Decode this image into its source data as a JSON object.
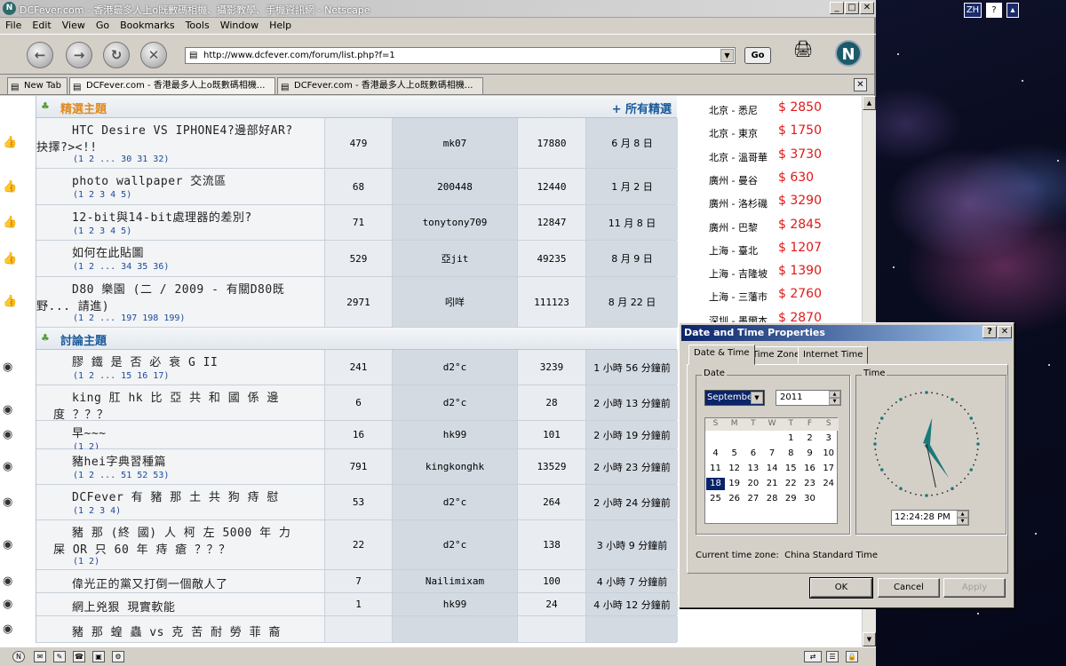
{
  "window": {
    "title": "DCFever.com - 香港最多人上o既數碼相機、攝影教學、手機資訊網 - Netscape",
    "minimize": "_",
    "maximize": "□",
    "close": "✕"
  },
  "tray": {
    "lang": "ZH",
    "help": "?"
  },
  "menu": [
    "File",
    "Edit",
    "View",
    "Go",
    "Bookmarks",
    "Tools",
    "Window",
    "Help"
  ],
  "nav": {
    "back": "←",
    "forward": "→",
    "reload": "↻",
    "stop": "✕",
    "url": "http://www.dcfever.com/forum/list.php?f=1",
    "go_label": "Go",
    "brand": "N"
  },
  "tabs": [
    {
      "label": "New Tab"
    },
    {
      "label": "DCFever.com - 香港最多人上o既數碼相機..."
    },
    {
      "label": "DCFever.com - 香港最多人上o既數碼相機..."
    }
  ],
  "tab_close": "✕",
  "forum": {
    "featured_header": "精選主題",
    "featured_link": "+ 所有精選",
    "discussion_header": "討論主題",
    "featured": [
      {
        "title1": "HTC Desire VS IPHONE4?邊部好AR?",
        "title2": "抉擇?><!!",
        "pages": "(1 2 ... 30 31 32)",
        "replies": "479",
        "author": "mk07",
        "views": "17880",
        "time": "6 月 8 日"
      },
      {
        "title1": "photo wallpaper 交流區",
        "title2": "",
        "pages": "(1 2 3 4 5)",
        "replies": "68",
        "author": "200448",
        "views": "12440",
        "time": "1 月 2 日"
      },
      {
        "title1": "12-bit與14-bit處理器的差別?",
        "title2": "",
        "pages": "(1 2 3 4 5)",
        "replies": "71",
        "author": "tonytony709",
        "views": "12847",
        "time": "11 月 8 日"
      },
      {
        "title1": "如何在此貼圖",
        "title2": "",
        "pages": "(1 2 ... 34 35 36)",
        "replies": "529",
        "author": "亞jit",
        "views": "49235",
        "time": "8 月 9 日"
      },
      {
        "title1": "D80 樂園 (二 / 2009 - 有關D80既",
        "title2": "野... 請進)",
        "pages": "(1 2 ... 197 198 199)",
        "replies": "2971",
        "author": "吲咩",
        "views": "111123",
        "time": "8 月 22 日"
      }
    ],
    "discussion": [
      {
        "title1": "膠 鐵 是 否 必 衰 G II",
        "title2": "",
        "pages": "(1 2 ... 15 16 17)",
        "replies": "241",
        "author": "d2°c",
        "views": "3239",
        "time": "1 小時 56 分鐘前"
      },
      {
        "title1": "king 肛 hk 比 亞 共 和 國 係 邊",
        "title2": "度 ？？？",
        "pages": "",
        "replies": "6",
        "author": "d2°c",
        "views": "28",
        "time": "2 小時 13 分鐘前"
      },
      {
        "title1": "早~~~",
        "title2": "",
        "pages": "(1 2)",
        "replies": "16",
        "author": "hk99",
        "views": "101",
        "time": "2 小時 19 分鐘前"
      },
      {
        "title1": "豬hei字典習種篇",
        "title2": "",
        "pages": "(1 2 ... 51 52 53)",
        "replies": "791",
        "author": "kingkonghk",
        "views": "13529",
        "time": "2 小時 23 分鐘前"
      },
      {
        "title1": "DCFever 有 豬 那 土 共 狗 痔 慰",
        "title2": "",
        "pages": "(1 2 3 4)",
        "replies": "53",
        "author": "d2°c",
        "views": "264",
        "time": "2 小時 24 分鐘前"
      },
      {
        "title1": "豬 那 (終 國) 人 柯 左 5000 年 力",
        "title2": "屎 OR 只 60 年 痔 瘡 ？？？",
        "pages": "(1 2)",
        "replies": "22",
        "author": "d2°c",
        "views": "138",
        "time": "3 小時 9 分鐘前"
      },
      {
        "title1": "偉光正的黨又打倒一個敵人了",
        "title2": "",
        "pages": "",
        "replies": "7",
        "author": "Nailimixam",
        "views": "100",
        "time": "4 小時 7 分鐘前"
      },
      {
        "title1": "網上兇狠 現實軟能",
        "title2": "",
        "pages": "",
        "replies": "1",
        "author": "hk99",
        "views": "24",
        "time": "4 小時 12 分鐘前"
      },
      {
        "title1": "豬 那 蝗 蟲 vs 克 苦 耐 勞 菲 裔",
        "title2": "",
        "pages": "",
        "replies": "",
        "author": "",
        "views": "",
        "time": ""
      }
    ]
  },
  "fares": [
    {
      "route": "北京 - 悉尼",
      "price": "$ 2850"
    },
    {
      "route": "北京 - 東京",
      "price": "$ 1750"
    },
    {
      "route": "北京 - 溫哥華",
      "price": "$ 3730"
    },
    {
      "route": "廣州 - 曼谷",
      "price": "$ 630"
    },
    {
      "route": "廣州 - 洛杉磯",
      "price": "$ 3290"
    },
    {
      "route": "廣州 - 巴黎",
      "price": "$ 2845"
    },
    {
      "route": "上海 - 臺北",
      "price": "$ 1207"
    },
    {
      "route": "上海 - 吉隆坡",
      "price": "$ 1390"
    },
    {
      "route": "上海 - 三藩市",
      "price": "$ 2760"
    },
    {
      "route": "深圳 - 墨爾本",
      "price": "$ 2870"
    }
  ],
  "dialog": {
    "title": "Date and Time Properties",
    "help": "?",
    "close": "✕",
    "tabs": [
      "Date & Time",
      "Time Zone",
      "Internet Time"
    ],
    "date_group": "Date",
    "time_group": "Time",
    "month": "September",
    "year": "2011",
    "weekdays": [
      "S",
      "M",
      "T",
      "W",
      "T",
      "F",
      "S"
    ],
    "days": [
      "1",
      "2",
      "3",
      "4",
      "5",
      "6",
      "7",
      "8",
      "9",
      "10",
      "11",
      "12",
      "13",
      "14",
      "15",
      "16",
      "17",
      "18",
      "19",
      "20",
      "21",
      "22",
      "23",
      "24",
      "25",
      "26",
      "27",
      "28",
      "29",
      "30"
    ],
    "selected_day": "18",
    "first_weekday_index": 4,
    "time": "12:24:28 PM",
    "clock": {
      "hour": 12,
      "minute": 24,
      "second": 28
    },
    "current_tz_label": "Current time zone:",
    "current_tz": "China Standard Time",
    "ok": "OK",
    "cancel": "Cancel",
    "apply": "Apply"
  },
  "colors": {
    "price": "#e01818",
    "link": "#1a4a9a",
    "dialog_title": "#0a246a",
    "section_header_text": "#1a5a9a"
  }
}
